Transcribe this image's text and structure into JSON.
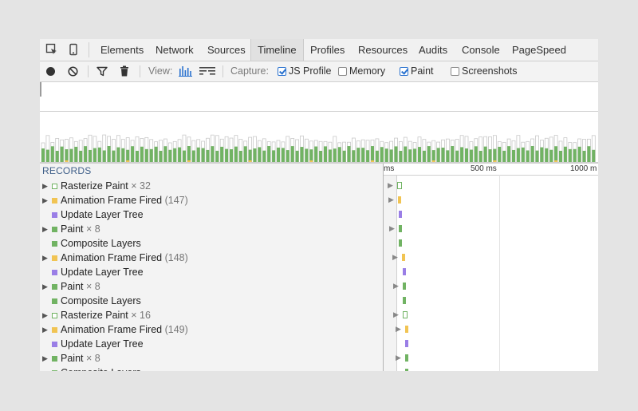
{
  "tabs": [
    {
      "label": "Elements",
      "selected": false
    },
    {
      "label": "Network",
      "selected": false
    },
    {
      "label": "Sources",
      "selected": false
    },
    {
      "label": "Timeline",
      "selected": true
    },
    {
      "label": "Profiles",
      "selected": false
    },
    {
      "label": "Resources",
      "selected": false
    },
    {
      "label": "Audits",
      "selected": false
    },
    {
      "label": "Console",
      "selected": false
    },
    {
      "label": "PageSpeed",
      "selected": false
    }
  ],
  "toolbar": {
    "view_label": "View:",
    "capture_label": "Capture:",
    "checkboxes": [
      {
        "label": "JS Profile",
        "checked": true
      },
      {
        "label": "Memory",
        "checked": false
      },
      {
        "label": "Paint",
        "checked": true
      },
      {
        "label": "Screenshots",
        "checked": false
      }
    ]
  },
  "records": {
    "header": "RECORDS",
    "items": [
      {
        "name": "Rasterize Paint",
        "count": "× 32",
        "type": "rasterize",
        "expandable": true
      },
      {
        "name": "Animation Frame Fired",
        "count": "(147)",
        "type": "scripting",
        "expandable": true
      },
      {
        "name": "Update Layer Tree",
        "count": "",
        "type": "rendering",
        "expandable": false
      },
      {
        "name": "Paint",
        "count": "× 8",
        "type": "painting",
        "expandable": true
      },
      {
        "name": "Composite Layers",
        "count": "",
        "type": "painting",
        "expandable": false
      },
      {
        "name": "Animation Frame Fired",
        "count": "(148)",
        "type": "scripting",
        "expandable": true
      },
      {
        "name": "Update Layer Tree",
        "count": "",
        "type": "rendering",
        "expandable": false
      },
      {
        "name": "Paint",
        "count": "× 8",
        "type": "painting",
        "expandable": true
      },
      {
        "name": "Composite Layers",
        "count": "",
        "type": "painting",
        "expandable": false
      },
      {
        "name": "Rasterize Paint",
        "count": "× 16",
        "type": "rasterize",
        "expandable": true
      },
      {
        "name": "Animation Frame Fired",
        "count": "(149)",
        "type": "scripting",
        "expandable": true
      },
      {
        "name": "Update Layer Tree",
        "count": "",
        "type": "rendering",
        "expandable": false
      },
      {
        "name": "Paint",
        "count": "× 8",
        "type": "painting",
        "expandable": true
      },
      {
        "name": "Composite Layers",
        "count": "",
        "type": "painting",
        "expandable": false
      }
    ]
  },
  "ruler": {
    "labels": [
      "ms",
      "500 ms",
      "1000 m"
    ]
  },
  "colors": {
    "scripting": "#f1c453",
    "rendering": "#9a7ee6",
    "painting": "#71b363",
    "rasterize": "#71b363",
    "accent": "#2a72cf"
  },
  "icons": [
    "inspect-icon",
    "device-icon",
    "record-icon",
    "clear-icon",
    "filter-icon",
    "trash-icon",
    "bars-view-icon",
    "flame-view-icon"
  ]
}
